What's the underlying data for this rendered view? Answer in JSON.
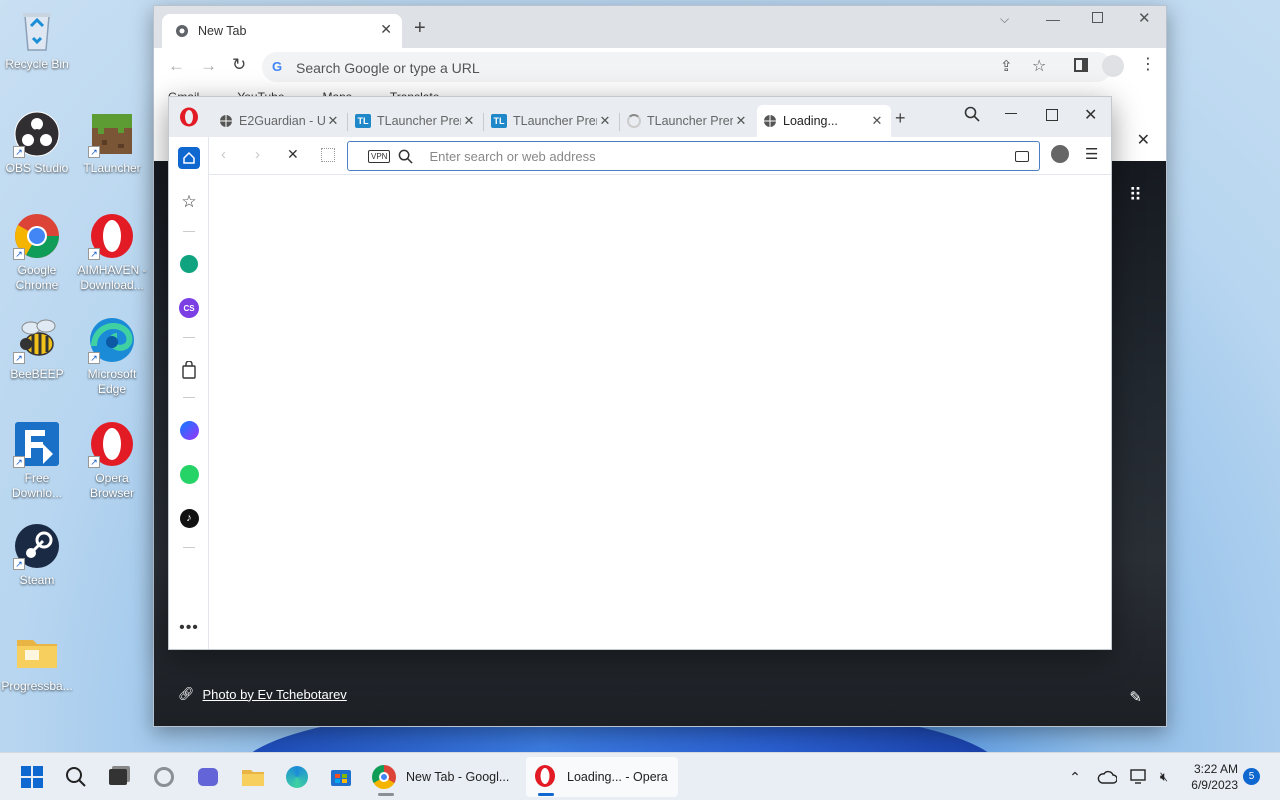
{
  "desktop": {
    "icons": [
      {
        "label": "Recycle Bin",
        "icon": "recycle-bin-icon"
      },
      {
        "label": "OBS Studio",
        "icon": "obs-icon"
      },
      {
        "label": "TLauncher",
        "icon": "minecraft-grass-icon"
      },
      {
        "label": "Google Chrome",
        "icon": "chrome-icon"
      },
      {
        "label": "AIMHAVEN - Download...",
        "icon": "opera-icon"
      },
      {
        "label": "BeeBEEP",
        "icon": "bee-icon"
      },
      {
        "label": "Microsoft Edge",
        "icon": "edge-icon"
      },
      {
        "label": "Free Downlo...",
        "icon": "download-manager-icon"
      },
      {
        "label": "Opera Browser",
        "icon": "opera-icon"
      },
      {
        "label": "Steam",
        "icon": "steam-icon"
      },
      {
        "label": "Progressba...",
        "icon": "folder-icon"
      }
    ]
  },
  "chrome": {
    "tab_title": "New Tab",
    "omnibox_placeholder": "Search Google or type a URL",
    "bookmarks": [
      "Gmail",
      "YouTube",
      "Maps",
      "Translate"
    ],
    "photo_credit": "Photo by Ev Tchebotarev"
  },
  "opera": {
    "tabs": [
      {
        "title": "E2Guardian - U",
        "icon": "globe-icon"
      },
      {
        "title": "TLauncher Prem",
        "icon": "tl-icon"
      },
      {
        "title": "TLauncher Prem",
        "icon": "tl-icon"
      },
      {
        "title": "TLauncher Prem",
        "icon": "spinner-icon"
      },
      {
        "title": "Loading...",
        "icon": "globe-icon"
      }
    ],
    "vpn_label": "VPN",
    "address_placeholder": "Enter search or web address",
    "tl_badge": "TL",
    "cs_badge": "CS"
  },
  "taskbar": {
    "apps": [
      {
        "label": "New Tab - Googl...",
        "icon": "chrome-icon"
      },
      {
        "label": "Loading... - Opera",
        "icon": "opera-icon"
      }
    ],
    "clock_time": "3:22 AM",
    "clock_date": "6/9/2023",
    "notification_count": "5"
  },
  "colors": {
    "opera_red": "#e21b25",
    "accent_blue": "#0f67d0",
    "chrome_blue": "#1a73e8"
  }
}
